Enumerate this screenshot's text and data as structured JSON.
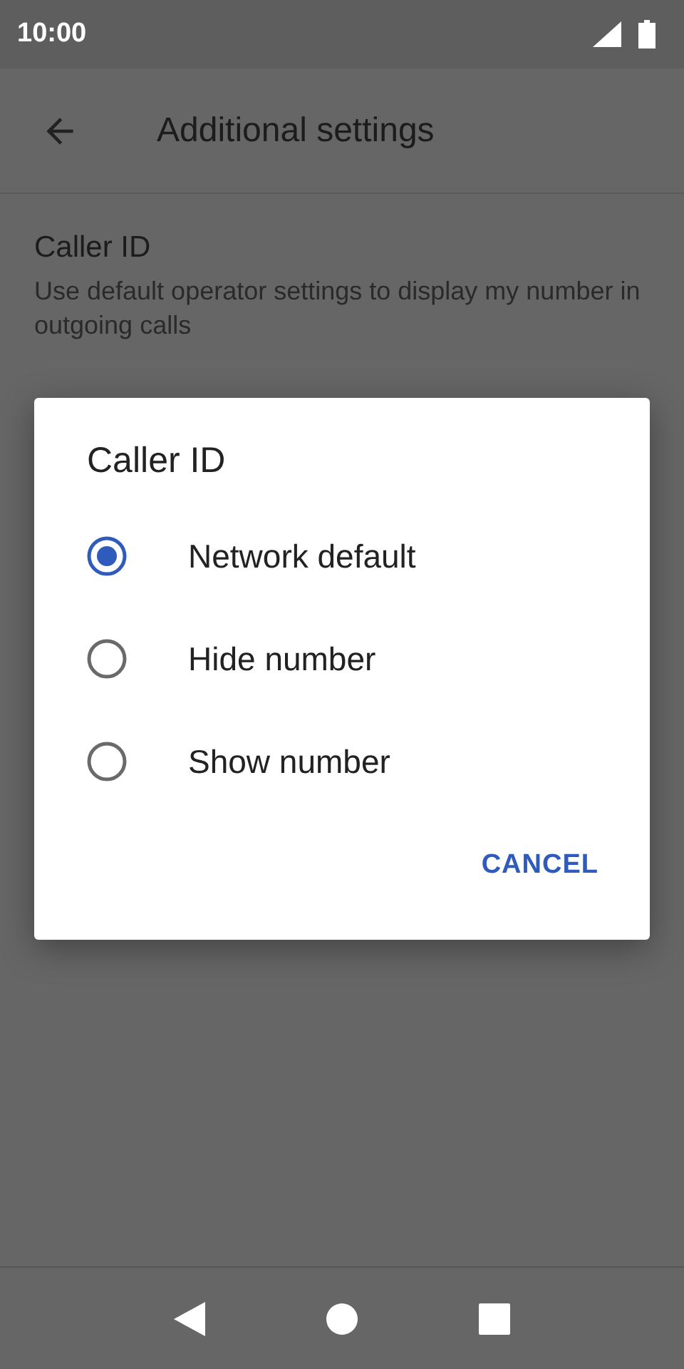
{
  "status_bar": {
    "time": "10:00"
  },
  "app_bar": {
    "title": "Additional settings"
  },
  "settings": [
    {
      "title": "Caller ID",
      "summary": "Use default operator settings to display my number in outgoing calls"
    }
  ],
  "dialog": {
    "title": "Caller ID",
    "options": [
      {
        "label": "Network default",
        "selected": true
      },
      {
        "label": "Hide number",
        "selected": false
      },
      {
        "label": "Show number",
        "selected": false
      }
    ],
    "buttons": [
      "CANCEL"
    ]
  }
}
